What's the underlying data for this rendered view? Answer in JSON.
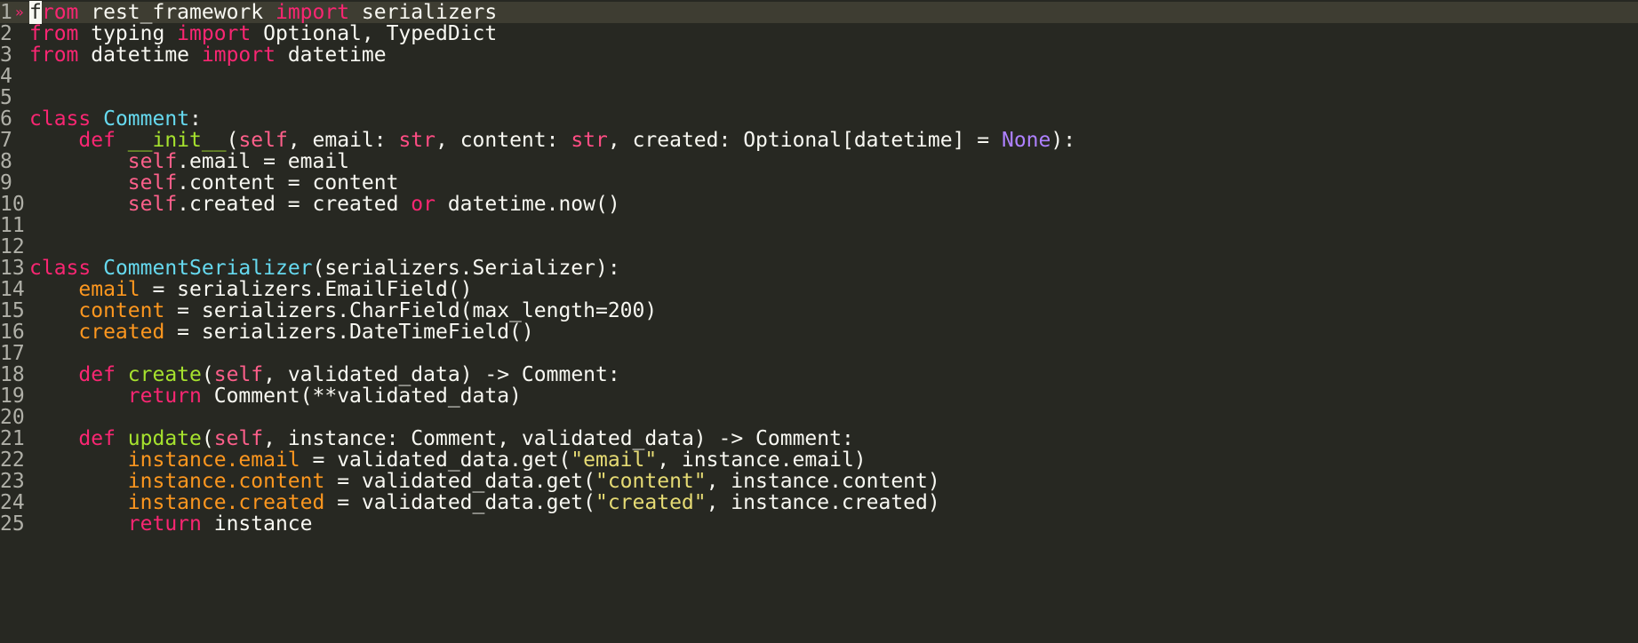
{
  "editor": {
    "colors": {
      "background": "#272822",
      "keyword": "#f92672",
      "class_name": "#66d9ef",
      "function_name": "#a6e22e",
      "string": "#e6db74",
      "constant": "#ae81ff",
      "attribute": "#fd971f"
    },
    "lines": [
      {
        "n": "1",
        "tokens": [
          [
            "kw",
            "from"
          ],
          [
            "plain",
            " rest_framework "
          ],
          [
            "kw",
            "import"
          ],
          [
            "plain",
            " serializers"
          ]
        ]
      },
      {
        "n": "2",
        "tokens": [
          [
            "kw",
            "from"
          ],
          [
            "plain",
            " typing "
          ],
          [
            "kw",
            "import"
          ],
          [
            "plain",
            " Optional, TypedDict"
          ]
        ]
      },
      {
        "n": "3",
        "tokens": [
          [
            "kw",
            "from"
          ],
          [
            "plain",
            " datetime "
          ],
          [
            "kw",
            "import"
          ],
          [
            "plain",
            " datetime"
          ]
        ]
      },
      {
        "n": "4",
        "tokens": []
      },
      {
        "n": "5",
        "tokens": []
      },
      {
        "n": "6",
        "tokens": [
          [
            "kw",
            "class"
          ],
          [
            "plain",
            " "
          ],
          [
            "class",
            "Comment"
          ],
          [
            "plain",
            ":"
          ]
        ]
      },
      {
        "n": "7",
        "tokens": [
          [
            "plain",
            "    "
          ],
          [
            "kw",
            "def"
          ],
          [
            "plain",
            " "
          ],
          [
            "fn",
            "__init__"
          ],
          [
            "plain",
            "("
          ],
          [
            "self",
            "self"
          ],
          [
            "plain",
            ", email: "
          ],
          [
            "type",
            "str"
          ],
          [
            "plain",
            ", content: "
          ],
          [
            "type",
            "str"
          ],
          [
            "plain",
            ", created: Optional[datetime] = "
          ],
          [
            "const",
            "None"
          ],
          [
            "plain",
            "):"
          ]
        ]
      },
      {
        "n": "8",
        "tokens": [
          [
            "plain",
            "        "
          ],
          [
            "self",
            "self"
          ],
          [
            "plain",
            ".email = email"
          ]
        ]
      },
      {
        "n": "9",
        "tokens": [
          [
            "plain",
            "        "
          ],
          [
            "self",
            "self"
          ],
          [
            "plain",
            ".content = content"
          ]
        ]
      },
      {
        "n": "10",
        "tokens": [
          [
            "plain",
            "        "
          ],
          [
            "self",
            "self"
          ],
          [
            "plain",
            ".created = created "
          ],
          [
            "kw",
            "or"
          ],
          [
            "plain",
            " datetime.now()"
          ]
        ]
      },
      {
        "n": "11",
        "tokens": []
      },
      {
        "n": "12",
        "tokens": []
      },
      {
        "n": "13",
        "tokens": [
          [
            "kw",
            "class"
          ],
          [
            "plain",
            " "
          ],
          [
            "class",
            "CommentSerializer"
          ],
          [
            "plain",
            "(serializers.Serializer):"
          ]
        ]
      },
      {
        "n": "14",
        "tokens": [
          [
            "plain",
            "    "
          ],
          [
            "param",
            "email"
          ],
          [
            "plain",
            " = serializers.EmailField()"
          ]
        ]
      },
      {
        "n": "15",
        "tokens": [
          [
            "plain",
            "    "
          ],
          [
            "param",
            "content"
          ],
          [
            "plain",
            " = serializers.CharField(max_length=200)"
          ]
        ]
      },
      {
        "n": "16",
        "tokens": [
          [
            "plain",
            "    "
          ],
          [
            "param",
            "created"
          ],
          [
            "plain",
            " = serializers.DateTimeField()"
          ]
        ]
      },
      {
        "n": "17",
        "tokens": []
      },
      {
        "n": "18",
        "tokens": [
          [
            "plain",
            "    "
          ],
          [
            "kw",
            "def"
          ],
          [
            "plain",
            " "
          ],
          [
            "fn",
            "create"
          ],
          [
            "plain",
            "("
          ],
          [
            "self",
            "self"
          ],
          [
            "plain",
            ", validated_data) -> Comment:"
          ]
        ]
      },
      {
        "n": "19",
        "tokens": [
          [
            "plain",
            "        "
          ],
          [
            "kw",
            "return"
          ],
          [
            "plain",
            " Comment(**validated_data)"
          ]
        ]
      },
      {
        "n": "20",
        "tokens": []
      },
      {
        "n": "21",
        "tokens": [
          [
            "plain",
            "    "
          ],
          [
            "kw",
            "def"
          ],
          [
            "plain",
            " "
          ],
          [
            "fn",
            "update"
          ],
          [
            "plain",
            "("
          ],
          [
            "self",
            "self"
          ],
          [
            "plain",
            ", instance: Comment, validated_data) -> Comment:"
          ]
        ]
      },
      {
        "n": "22",
        "tokens": [
          [
            "plain",
            "        "
          ],
          [
            "param",
            "instance.email"
          ],
          [
            "plain",
            " = validated_data.get("
          ],
          [
            "str",
            "\"email\""
          ],
          [
            "plain",
            ", instance.email)"
          ]
        ]
      },
      {
        "n": "23",
        "tokens": [
          [
            "plain",
            "        "
          ],
          [
            "param",
            "instance.content"
          ],
          [
            "plain",
            " = validated_data.get("
          ],
          [
            "str",
            "\"content\""
          ],
          [
            "plain",
            ", instance.content)"
          ]
        ]
      },
      {
        "n": "24",
        "tokens": [
          [
            "plain",
            "        "
          ],
          [
            "param",
            "instance.created"
          ],
          [
            "plain",
            " = validated_data.get("
          ],
          [
            "str",
            "\"created\""
          ],
          [
            "plain",
            ", instance.created)"
          ]
        ]
      },
      {
        "n": "25",
        "tokens": [
          [
            "plain",
            "        "
          ],
          [
            "kw",
            "return"
          ],
          [
            "plain",
            " instance"
          ]
        ]
      }
    ],
    "cursor": {
      "line": "1",
      "marker": "»"
    }
  }
}
